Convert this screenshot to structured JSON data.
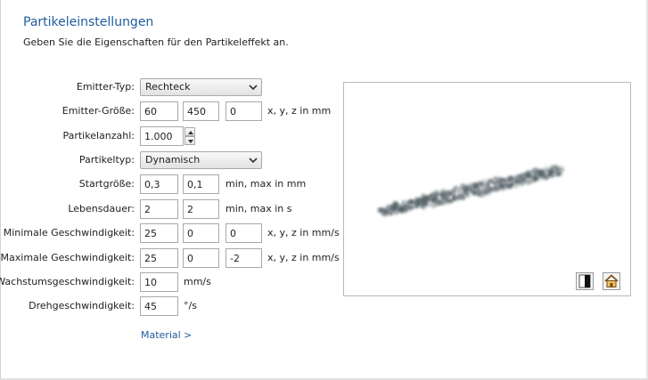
{
  "header": {
    "title": "Partikeleinstellungen",
    "subtitle": "Geben Sie die Eigenschaften für den Partikeleffekt an."
  },
  "form": {
    "emitter_type": {
      "label": "Emitter-Typ:",
      "value": "Rechteck"
    },
    "emitter_size": {
      "label": "Emitter-Größe:",
      "x": "60",
      "y": "450",
      "z": "0",
      "unit": "x, y, z in mm"
    },
    "particle_count": {
      "label": "Partikelanzahl:",
      "value": "1.000"
    },
    "particle_type": {
      "label": "Partikeltyp:",
      "value": "Dynamisch"
    },
    "start_size": {
      "label": "Startgröße:",
      "min": "0,3",
      "max": "0,1",
      "unit": "min, max in mm"
    },
    "lifetime": {
      "label": "Lebensdauer:",
      "min": "2",
      "max": "2",
      "unit": "min, max in s"
    },
    "min_speed": {
      "label": "Minimale Geschwindigkeit:",
      "x": "25",
      "y": "0",
      "z": "0",
      "unit": "x, y, z in mm/s"
    },
    "max_speed": {
      "label": "Maximale Geschwindigkeit:",
      "x": "25",
      "y": "0",
      "z": "-2",
      "unit": "x, y, z in mm/s"
    },
    "growth_speed": {
      "label": "Wachstumsgeschwindigkeit:",
      "value": "10",
      "unit": "mm/s"
    },
    "rotation_speed": {
      "label": "Drehgeschwindigkeit:",
      "value": "45",
      "unit": "°/s"
    }
  },
  "material_link": "Material >",
  "preview": {
    "particle_color": "#4d5a60",
    "tools": [
      "background-toggle-icon",
      "home-view-icon"
    ]
  },
  "colors": {
    "accent": "#1f5c9c",
    "border": "#a9a9a9"
  }
}
